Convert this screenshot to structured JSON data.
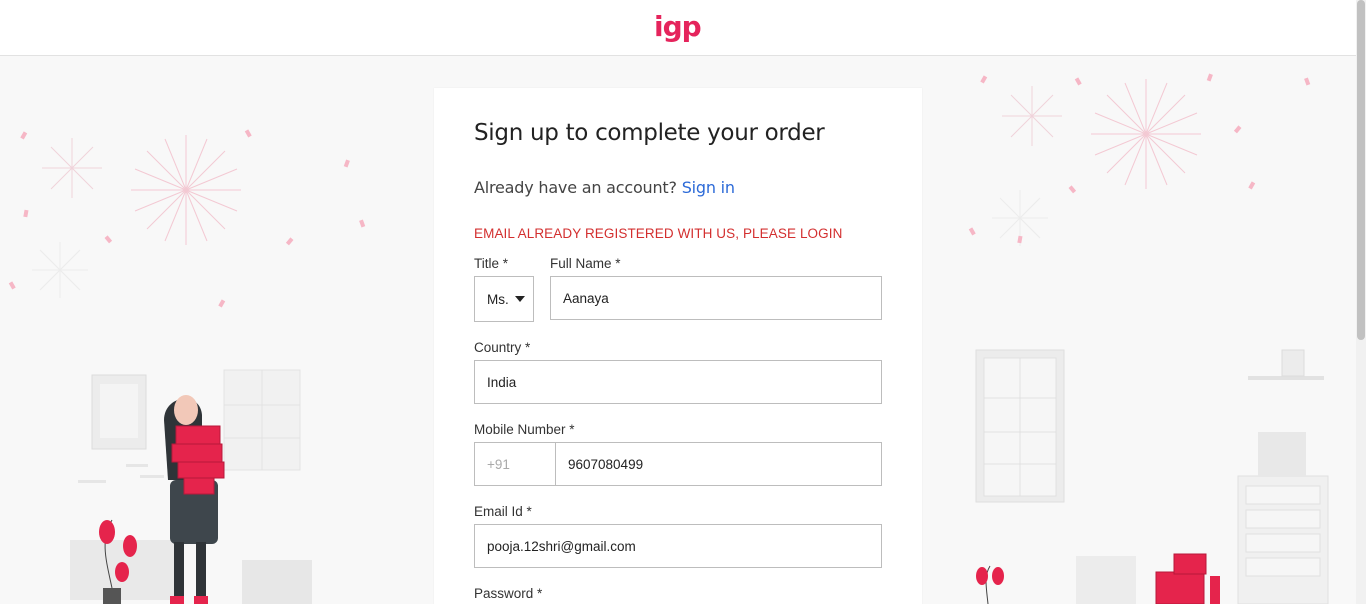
{
  "header": {
    "logo_text": "igp"
  },
  "form": {
    "heading": "Sign up to complete your order",
    "subtitle_text": "Already have an account?",
    "signin_label": "Sign in",
    "error_message": "EMAIL ALREADY REGISTERED WITH US, PLEASE LOGIN",
    "title_label": "Title *",
    "title_value": "Ms.",
    "fullname_label": "Full Name *",
    "fullname_value": "Aanaya",
    "country_label": "Country *",
    "country_value": "India",
    "mobile_label": "Mobile Number *",
    "mobile_prefix": "+91",
    "mobile_value": "9607080499",
    "email_label": "Email Id *",
    "email_value": "pooja.12shri@gmail.com",
    "password_label": "Password *"
  },
  "colors": {
    "brand": "#e5245c",
    "link": "#2c6ad8",
    "error": "#d32f2f"
  }
}
